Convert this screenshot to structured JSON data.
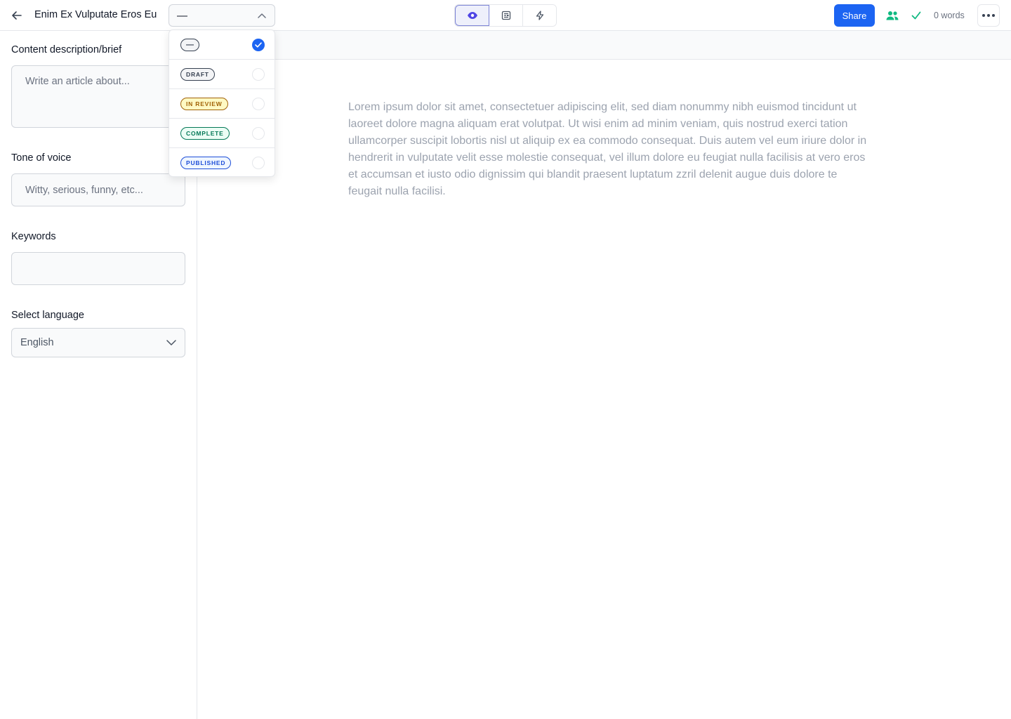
{
  "header": {
    "doc_title": "Enim Ex Vulputate Eros Eu",
    "status_value": "—",
    "share_label": "Share",
    "word_count": "0 words",
    "icons": {
      "back": "arrow-left-icon",
      "chevron": "chevron-up-icon",
      "preview": "eye-icon",
      "outline": "document-icon",
      "ai": "lightning-icon",
      "collaborators": "users-icon",
      "saved": "check-icon",
      "more": "ellipsis-icon"
    },
    "colors": {
      "accent": "#1c64f2",
      "collab": "#10b981"
    }
  },
  "sidebar": {
    "brief_label": "Content description/brief",
    "brief_placeholder": "Write an article about...",
    "tone_label": "Tone of voice",
    "tone_placeholder": "Witty, serious, funny, etc...",
    "keywords_label": "Keywords",
    "keywords_value": "",
    "language_label": "Select language",
    "language_value": "English"
  },
  "editor": {
    "placeholder_text": "Lorem ipsum dolor sit amet, consectetuer adipiscing elit, sed diam nonummy nibh euismod tincidunt ut laoreet dolore magna aliquam erat volutpat. Ut wisi enim ad minim veniam, quis nostrud exerci tation ullamcorper suscipit lobortis nisl ut aliquip ex ea commodo consequat. Duis autem vel eum iriure dolor in hendrerit in vulputate velit esse molestie consequat, vel illum dolore eu feugiat nulla facilisis at vero eros et accumsan et iusto odio dignissim qui blandit praesent luptatum zzril delenit augue duis dolore te feugait nulla facilisi."
  },
  "status_dropdown": {
    "options": [
      {
        "label": "—",
        "selected": true,
        "color": "#374151",
        "bg": "#f3f4f6"
      },
      {
        "label": "DRAFT",
        "selected": false,
        "color": "#374151",
        "bg": "#f3f4f6"
      },
      {
        "label": "IN REVIEW",
        "selected": false,
        "color": "#a16207",
        "bg": "#fef9c3"
      },
      {
        "label": "COMPLETE",
        "selected": false,
        "color": "#047857",
        "bg": "#ecfdf5"
      },
      {
        "label": "PUBLISHED",
        "selected": false,
        "color": "#1d4ed8",
        "bg": "#eff6ff"
      }
    ]
  }
}
